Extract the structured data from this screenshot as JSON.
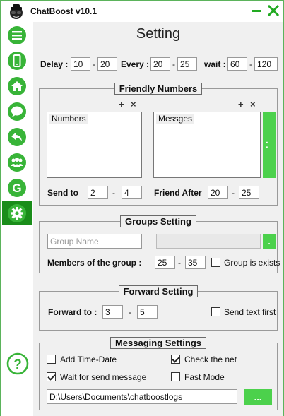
{
  "titlebar": {
    "title": "ChatBoost  v10.1",
    "logo_icon": "spy-logo-icon",
    "minimize_icon": "minimize-icon",
    "close_icon": "close-icon"
  },
  "sidebar": {
    "accent": "#38b438",
    "active": "#1a8d1a",
    "items": [
      {
        "icon": "menu-icon"
      },
      {
        "icon": "phone-icon"
      },
      {
        "icon": "home-icon"
      },
      {
        "icon": "chat-icon"
      },
      {
        "icon": "reply-icon"
      },
      {
        "icon": "group-icon"
      },
      {
        "icon": "g-letter-icon",
        "glyph": "G"
      },
      {
        "icon": "gear-icon"
      }
    ],
    "help_icon": "help-icon",
    "help_glyph": "?"
  },
  "page_title": "Setting",
  "timing": {
    "delay_label": "Delay :",
    "delay_min": "10",
    "delay_max": "20",
    "every_label": "Every :",
    "every_min": "20",
    "every_max": "25",
    "wait_label": "wait :",
    "wait_min": "60",
    "wait_max": "120",
    "dash": "-"
  },
  "friendly": {
    "title": "Friendly Numbers",
    "plus": "+",
    "x": "×",
    "numbers_header": "Numbers",
    "messages_header": "Messges",
    "side_button": ". .",
    "send_to_label": "Send to",
    "send_min": "2",
    "send_max": "4",
    "friend_after_label": "Friend After",
    "after_min": "20",
    "after_max": "25"
  },
  "groups": {
    "title": "Groups Setting",
    "group_name_placeholder": "Group Name",
    "second_field": "",
    "dot_button": ".",
    "members_label": "Members of the group :",
    "members_min": "25",
    "members_max": "35",
    "exists_label": "Group is exists",
    "exists_checked": false
  },
  "forward": {
    "title": "Forward Setting",
    "forward_label": "Forward to :",
    "forward_min": "3",
    "forward_max": "5",
    "send_text_label": "Send text first",
    "send_text_checked": false
  },
  "messaging": {
    "title": "Messaging Settings",
    "add_time_label": "Add Time-Date",
    "add_time_checked": false,
    "check_net_label": "Check the net",
    "check_net_checked": true,
    "wait_send_label": "Wait for send message",
    "wait_send_checked": true,
    "fast_mode_label": "Fast Mode",
    "fast_mode_checked": false,
    "log_path": "D:\\Users\\Documents\\chatboostlogs",
    "browse_button": "..."
  }
}
